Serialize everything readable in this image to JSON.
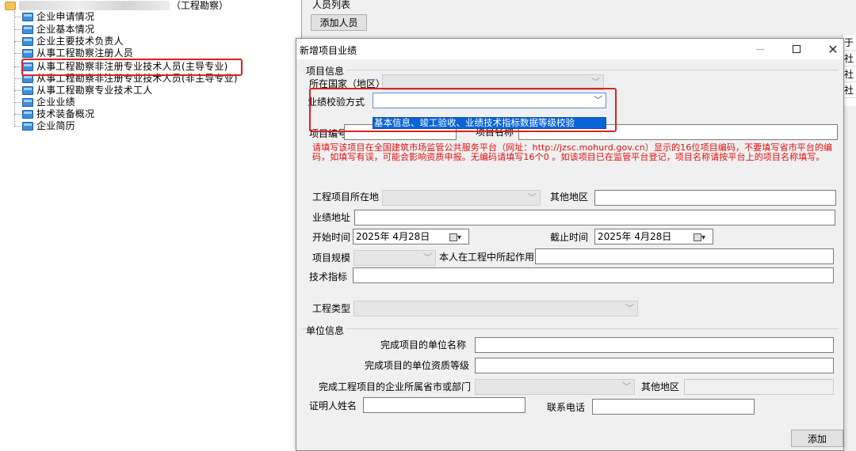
{
  "tree": {
    "root_suffix": "（工程勘察）",
    "items": [
      "企业申请情况",
      "企业基本情况",
      "企业主要技术负责人",
      "从事工程勘察注册人员",
      "从事工程勘察非注册专业技术人员(主导专业)",
      "从事工程勘察非注册专业技术人员(非主导专业)",
      "从事工程勘察专业技术工人",
      "企业业绩",
      "技术装备概况",
      "企业简历"
    ]
  },
  "background": {
    "group_label": "人员列表",
    "add_person_button": "添加人员",
    "right_col": [
      "于",
      "社",
      "社",
      "社"
    ]
  },
  "dialog": {
    "title": "新增项目业绩",
    "project_info_group": "项目信息",
    "country_label": "所在国家（地区）",
    "verify_method_label": "业绩校验方式",
    "verify_method_option": "基本信息、竣工验收、业绩技术指标数据等级校验",
    "project_code_label": "项目编号",
    "project_name_label": "项目名称",
    "hint": "请填写该项目在全国建筑市场监管公共服务平台（网址：http://jzsc.mohurd.gov.cn）显示的16位项目编码，不要填写省市平台的编码，如填写有误，可能会影响资质申报。无编码请填写16个0 。如该项目已在监管平台登记，项目名称请按平台上的项目名称填写。",
    "location_label": "工程项目所在地",
    "other_region_label": "其他地区",
    "address_label": "业绩地址",
    "start_label": "开始时间",
    "start_value": "2025年  4月28日",
    "end_label": "截止时间",
    "end_value": "2025年  4月28日",
    "scale_label": "项目规模",
    "role_label": "本人在工程中所起作用",
    "tech_label": "技术指标",
    "type_label": "工程类型",
    "unit_group": "单位信息",
    "unit_name_label": "完成项目的单位名称",
    "unit_grade_label": "完成项目的单位资质等级",
    "unit_province_label": "完成工程项目的企业所属省市或部门",
    "unit_other_region_label": "其他地区",
    "witness_label": "证明人姓名",
    "phone_label": "联系电话",
    "add_button": "添加",
    "minimize_icon": "minimize-icon",
    "maximize_icon": "maximize-icon",
    "close_icon": "close-icon"
  },
  "colors": {
    "highlight_red": "#e02020",
    "hint_red": "#e01010",
    "selection_blue": "#0a64d6"
  }
}
